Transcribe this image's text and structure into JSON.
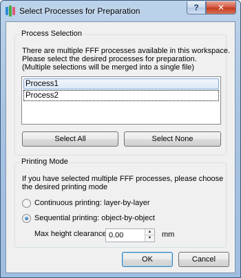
{
  "window": {
    "title": "Select Processes for Preparation",
    "help_label": "?",
    "close_label": "✕"
  },
  "process_selection": {
    "legend": "Process Selection",
    "description_lines": [
      "There are multiple FFF processes available in this workspace.",
      "Please select the desired processes for preparation.",
      "(Multiple selections will be merged into a single file)"
    ],
    "processes": [
      "Process1",
      "Process2"
    ],
    "selected_process": "Process1",
    "select_all_label": "Select All",
    "select_none_label": "Select None"
  },
  "printing_mode": {
    "legend": "Printing Mode",
    "description_lines": [
      "If you have selected multiple FFF processes, please choose",
      "the desired printing mode"
    ],
    "options": [
      "Continuous printing: layer-by-layer",
      "Sequential printing: object-by-object"
    ],
    "selected_option": "Sequential printing: object-by-object",
    "clearance_label": "Max height clearance",
    "clearance_value": "0.00",
    "clearance_unit": "mm"
  },
  "footer": {
    "ok_label": "OK",
    "cancel_label": "Cancel"
  },
  "colors": {
    "title_bar": "#a9c4e2",
    "close_button": "#c23a1f",
    "selection": "#dce9f8"
  },
  "icons": [
    "app-icon",
    "help-icon",
    "close-icon",
    "spin-up-icon",
    "spin-down-icon"
  ]
}
